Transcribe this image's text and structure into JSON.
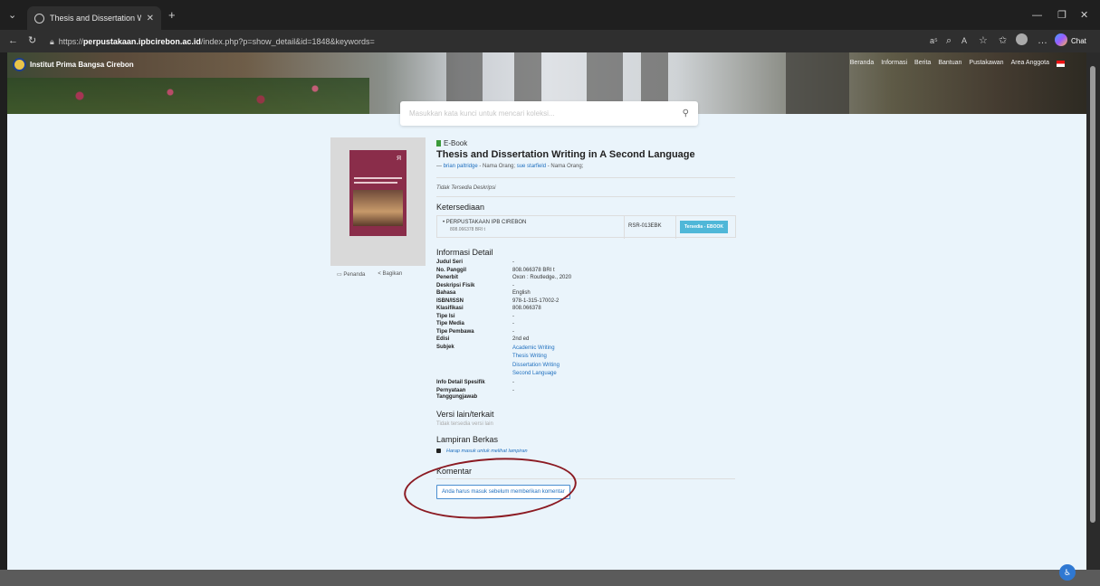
{
  "browser": {
    "tab_title": "Thesis and Dissertation Writing in",
    "tab_close": "✕",
    "new_tab": "+",
    "url_prefix": "https://",
    "url_host": "perpustakaan.ipbcirebon.ac.id",
    "url_path": "/index.php?p=show_detail&id=1848&keywords=",
    "chat_label": "Chat"
  },
  "site": {
    "logo_text": "Institut Prima Bangsa Cirebon",
    "nav": [
      "Beranda",
      "Informasi",
      "Berita",
      "Bantuan",
      "Pustakawan",
      "Area Anggota"
    ],
    "search_placeholder": "Masukkan kata kunci untuk mencari koleksi..."
  },
  "record": {
    "type_label": "E-Book",
    "title": "Thesis and Dissertation Writing in A Second Language",
    "authors_prefix": "— ",
    "author1": "brian paltridge",
    "author1_role": " - Nama Orang; ",
    "author2": "sue starfield",
    "author2_role": " - Nama Orang;",
    "description": "Tidak Tersedia Deskripsi",
    "bookmark_label": "Penanda",
    "share_label": "Bagikan",
    "availability_heading": "Ketersediaan",
    "availability": {
      "location": "PERPUSTAKAAN IPB CIREBON",
      "call_number": "808.066378 BRI t",
      "item_code": "RSR-013EBK",
      "status": "Tersedia - EBOOK"
    },
    "detail_heading": "Informasi Detail",
    "details": [
      {
        "k": "Judul Seri",
        "v": "-"
      },
      {
        "k": "No. Panggil",
        "v": "808.066378 BRI t"
      },
      {
        "k": "Penerbit",
        "v": "Oxon : Routledge., 2020"
      },
      {
        "k": "Deskripsi Fisik",
        "v": "-"
      },
      {
        "k": "Bahasa",
        "v": "English"
      },
      {
        "k": "ISBN/ISSN",
        "v": "978-1-315-17002-2"
      },
      {
        "k": "Klasifikasi",
        "v": "808.066378"
      },
      {
        "k": "Tipe Isi",
        "v": "-"
      },
      {
        "k": "Tipe Media",
        "v": "-"
      },
      {
        "k": "Tipe Pembawa",
        "v": "-"
      },
      {
        "k": "Edisi",
        "v": "2nd ed"
      }
    ],
    "subject_label": "Subjek",
    "subjects": [
      "Academic Writing",
      "Thesis Writing",
      "Dissertation Writing",
      "Second Language"
    ],
    "details2": [
      {
        "k": "Info Detail Spesifik",
        "v": "-"
      },
      {
        "k": "Pernyataan Tanggungjawab",
        "v": "-"
      }
    ],
    "versions_heading": "Versi lain/terkait",
    "versions_note": "Tidak tersedia versi lain",
    "attachments_heading": "Lampiran Berkas",
    "attachments_link": "Harap masuk untuk melihat lampiran",
    "comments_heading": "Komentar",
    "comment_button": "Anda harus masuk sebelum memberikan komentar"
  },
  "colors": {
    "annotation_circle": "#8b1a22",
    "link": "#1f6fbf",
    "status_badge": "#4fb7d8"
  }
}
